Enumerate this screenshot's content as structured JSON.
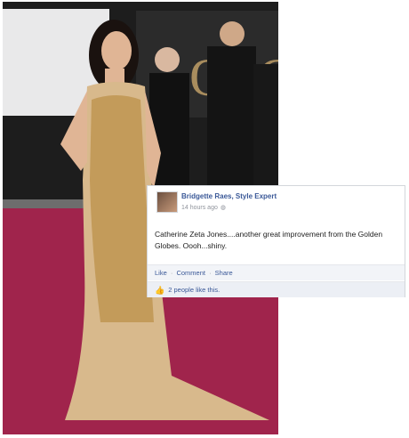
{
  "photo": {
    "description_icon": "red-carpet-photo"
  },
  "post": {
    "author": "Bridgette Raes, Style Expert",
    "time": "14 hours ago",
    "globe_icon": "globe-icon",
    "text": "Catherine Zeta Jones....another great improvement from the Golden Globes. Oooh...shiny.",
    "actions": {
      "like": "Like",
      "comment": "Comment",
      "share": "Share",
      "separator": "·"
    },
    "likes_text": "2 people like this.",
    "colors": {
      "link": "#3b5998",
      "meta": "#90949c"
    }
  }
}
